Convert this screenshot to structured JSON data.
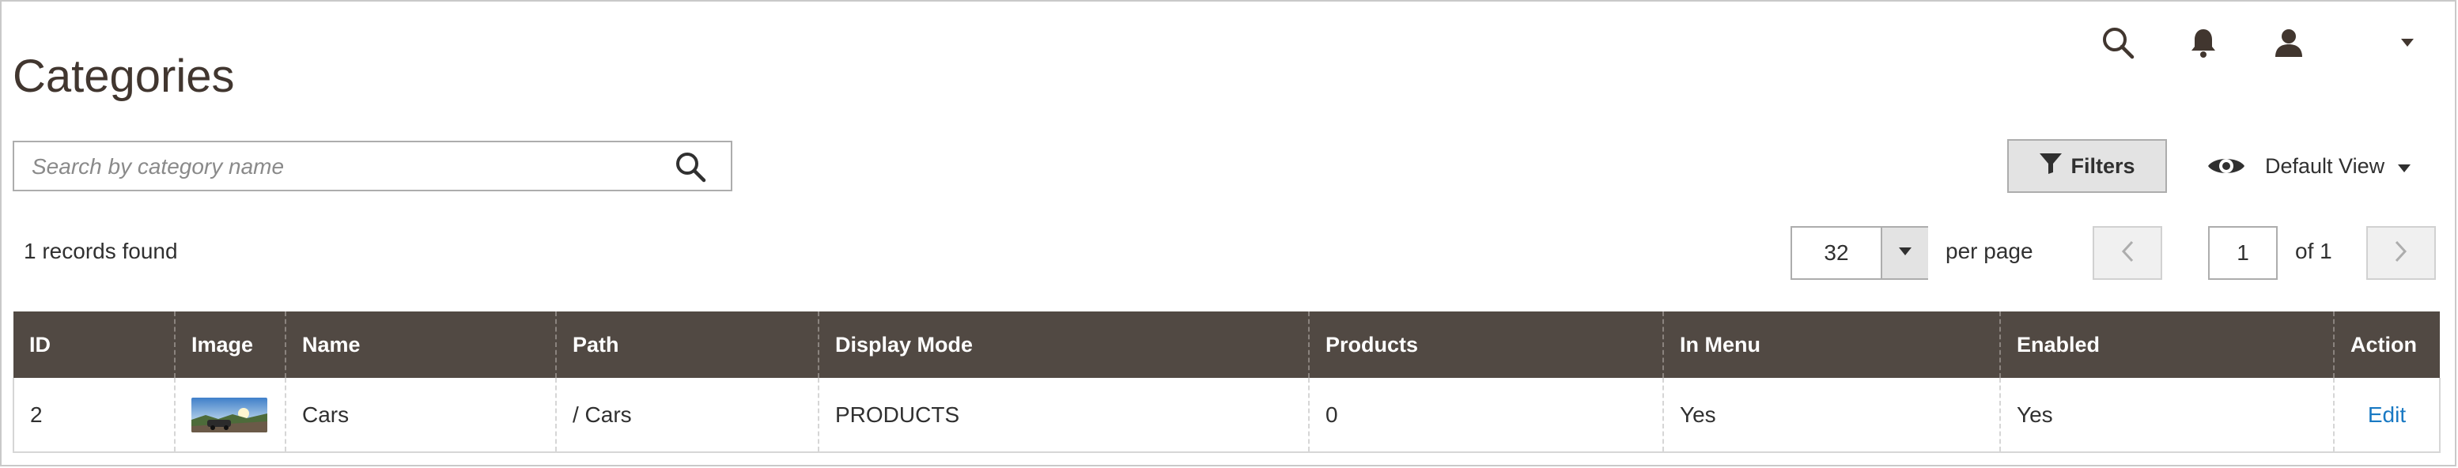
{
  "page": {
    "title": "Categories"
  },
  "header": {
    "icons": [
      "search-icon",
      "bell-icon",
      "user-icon",
      "caret-down-icon"
    ]
  },
  "search": {
    "placeholder": "Search by category name",
    "value": ""
  },
  "toolbar": {
    "filters_label": "Filters",
    "view_label": "Default View"
  },
  "records": {
    "text": "1 records found"
  },
  "pagination": {
    "per_page_value": "32",
    "per_page_label": "per page",
    "current_page": "1",
    "total_label": "of 1"
  },
  "grid": {
    "columns": [
      "ID",
      "Image",
      "Name",
      "Path",
      "Display Mode",
      "Products",
      "In Menu",
      "Enabled",
      "Action"
    ],
    "rows": [
      {
        "id": "2",
        "image": "car-thumbnail",
        "name": "Cars",
        "path": "/ Cars",
        "display_mode": "PRODUCTS",
        "products": "0",
        "in_menu": "Yes",
        "enabled": "Yes",
        "action": "Edit"
      }
    ]
  },
  "colors": {
    "header_bg": "#514943",
    "link": "#1979c3",
    "title": "#41362f"
  }
}
